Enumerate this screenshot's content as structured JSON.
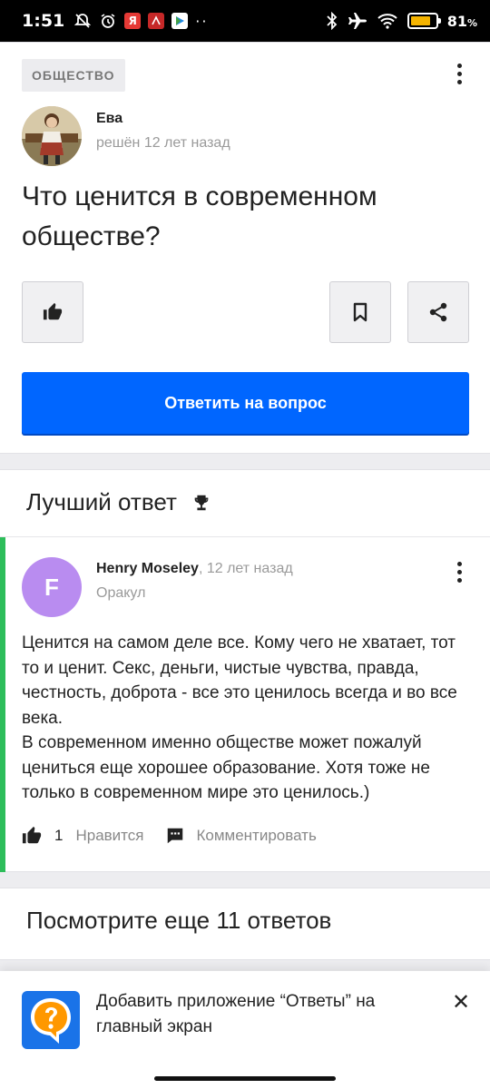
{
  "status_bar": {
    "time": "1:51",
    "battery_percent_label": "81",
    "battery_percent_suffix": "%",
    "battery_level": 0.81,
    "app_yandex_label": "Я"
  },
  "question_card": {
    "category": "ОБЩЕСТВО",
    "author_name": "Ева",
    "author_meta": "решён 12 лет назад",
    "title": "Что ценится в современном обществе?",
    "answer_button_label": "Ответить на вопрос"
  },
  "best_answer": {
    "header": "Лучший ответ",
    "avatar_letter": "F",
    "author_name": "Henry Moseley",
    "author_time": ", 12 лет назад",
    "author_rank": "Оракул",
    "text": "Ценится на самом деле все. Кому чего не хватает, тот то и ценит. Секс, деньги, чистые чувства, правда, честность, доброта - все это ценилось всегда и во все века.\nВ современном именно обществе может пожалуй цениться еще хорошее образование. Хотя тоже не только в современном мире это ценилось.)",
    "like_count": "1",
    "like_label": "Нравится",
    "comment_label": "Комментировать"
  },
  "more_answers": {
    "title": "Посмотрите еще 11 ответов"
  },
  "install_banner": {
    "text": "Добавить приложение “Ответы” на главный экран"
  },
  "colors": {
    "primary": "#0066ff",
    "best_answer_accent": "#2dbd5a",
    "avatar_f": "#b98cf0"
  }
}
